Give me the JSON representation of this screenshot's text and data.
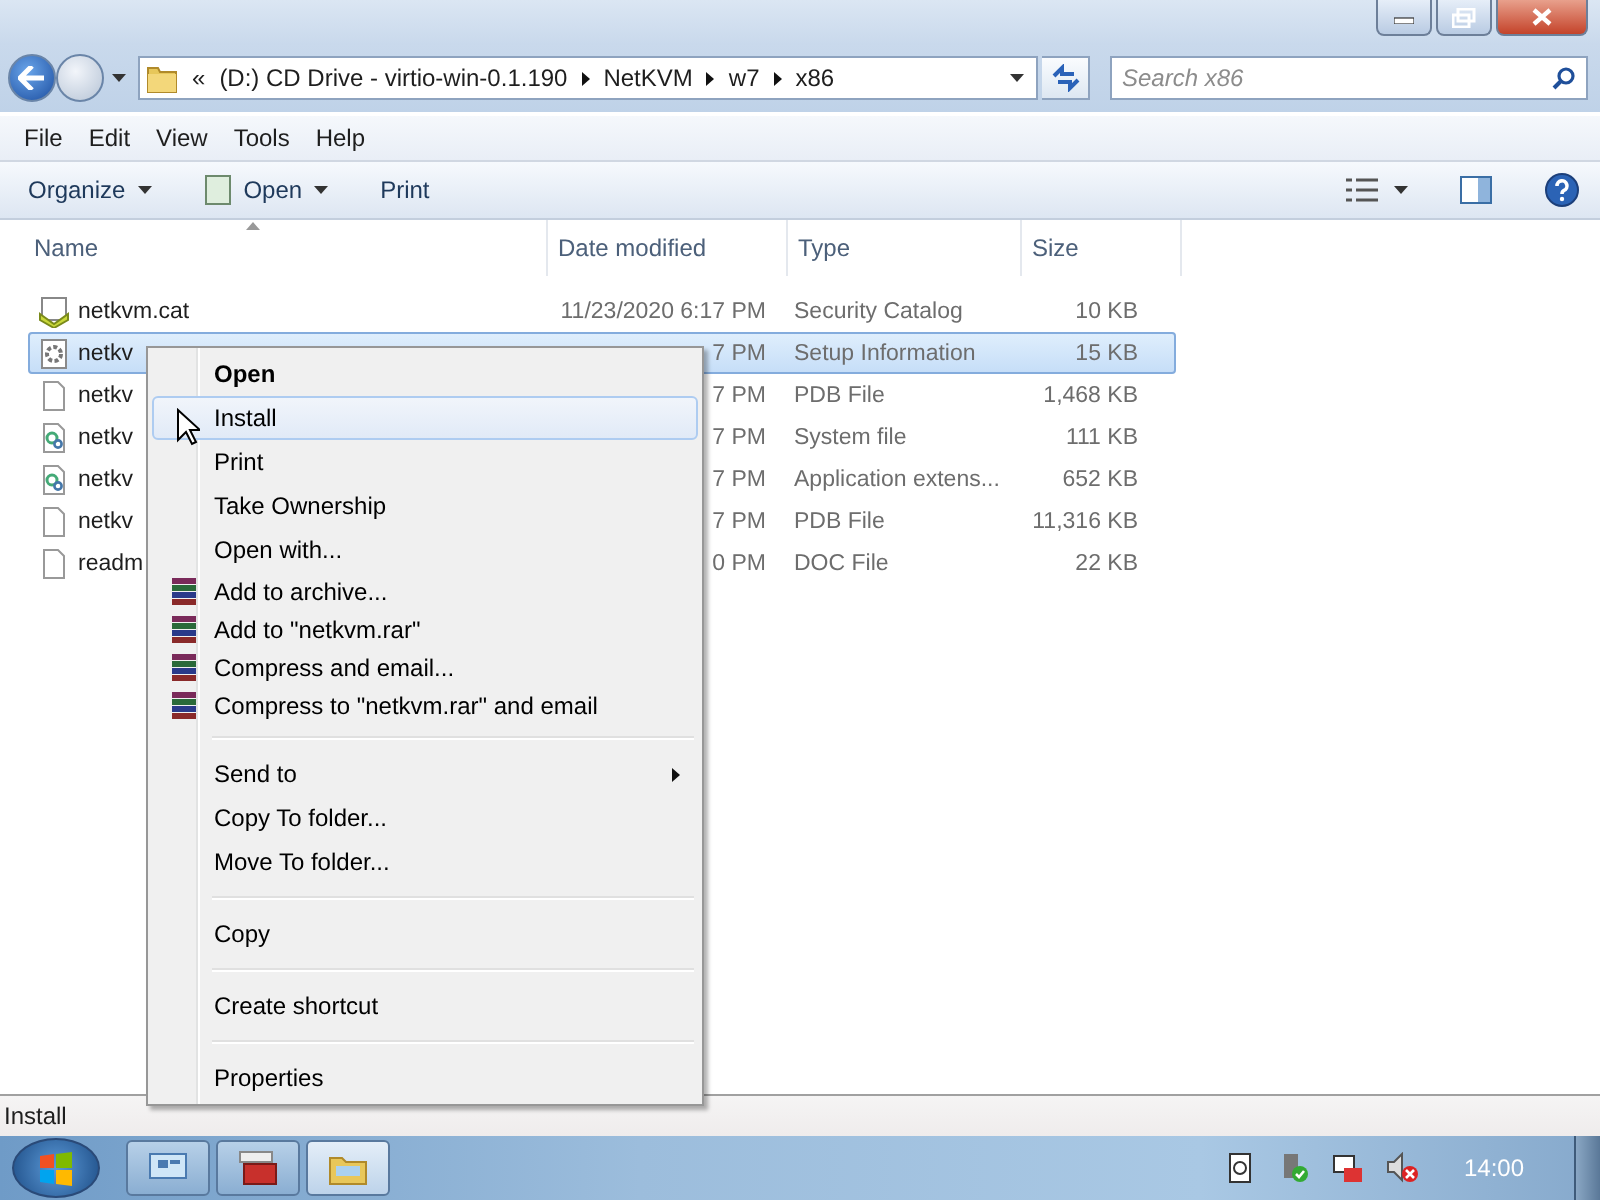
{
  "address": {
    "chevron": "«",
    "crumbs": [
      "(D:) CD Drive - virtio-win-0.1.190",
      "NetKVM",
      "w7",
      "x86"
    ]
  },
  "search": {
    "placeholder": "Search x86"
  },
  "menu_bar": [
    "File",
    "Edit",
    "View",
    "Tools",
    "Help"
  ],
  "commands": [
    {
      "label": "Organize",
      "dropdown": true,
      "icon": false
    },
    {
      "label": "Open",
      "dropdown": true,
      "icon": true
    },
    {
      "label": "Print",
      "dropdown": false,
      "icon": false
    }
  ],
  "columns": [
    "Name",
    "Date modified",
    "Type",
    "Size"
  ],
  "rows": [
    {
      "kind": "catalog",
      "name": "netkvm.cat",
      "date": "11/23/2020 6:17 PM",
      "type": "Security Catalog",
      "size": "10 KB",
      "selected": false
    },
    {
      "kind": "setup",
      "name": "netkv",
      "date": "7 PM",
      "type": "Setup Information",
      "size": "15 KB",
      "selected": true
    },
    {
      "kind": "blank",
      "name": "netkv",
      "date": "7 PM",
      "type": "PDB File",
      "size": "1,468 KB",
      "selected": false
    },
    {
      "kind": "gear",
      "name": "netkv",
      "date": "7 PM",
      "type": "System file",
      "size": "111 KB",
      "selected": false
    },
    {
      "kind": "gear",
      "name": "netkv",
      "date": "7 PM",
      "type": "Application extens...",
      "size": "652 KB",
      "selected": false
    },
    {
      "kind": "blank",
      "name": "netkv",
      "date": "7 PM",
      "type": "PDB File",
      "size": "11,316 KB",
      "selected": false
    },
    {
      "kind": "blank",
      "name": "readm",
      "date": "0 PM",
      "type": "DOC File",
      "size": "22 KB",
      "selected": false
    }
  ],
  "context_menu": [
    {
      "kind": "item",
      "label": "Open",
      "default": true,
      "selected": false
    },
    {
      "kind": "item",
      "label": "Install",
      "default": false,
      "selected": true
    },
    {
      "kind": "item",
      "label": "Print",
      "default": false,
      "selected": false
    },
    {
      "kind": "item",
      "label": "Take Ownership",
      "default": false,
      "selected": false
    },
    {
      "kind": "item",
      "label": "Open with...",
      "default": false,
      "selected": false
    },
    {
      "kind": "archive",
      "label": "Add to archive...",
      "default": false,
      "selected": false
    },
    {
      "kind": "archive",
      "label": "Add to \"netkvm.rar\"",
      "default": false,
      "selected": false
    },
    {
      "kind": "archive",
      "label": "Compress and email...",
      "default": false,
      "selected": false
    },
    {
      "kind": "archive",
      "label": "Compress to \"netkvm.rar\" and email",
      "default": false,
      "selected": false
    },
    {
      "kind": "separator"
    },
    {
      "kind": "submenu",
      "label": "Send to",
      "default": false,
      "selected": false
    },
    {
      "kind": "item",
      "label": "Copy To folder...",
      "default": false,
      "selected": false
    },
    {
      "kind": "item",
      "label": "Move To folder...",
      "default": false,
      "selected": false
    },
    {
      "kind": "separator"
    },
    {
      "kind": "item",
      "label": "Copy",
      "default": false,
      "selected": false
    },
    {
      "kind": "separator"
    },
    {
      "kind": "item",
      "label": "Create shortcut",
      "default": false,
      "selected": false
    },
    {
      "kind": "separator"
    },
    {
      "kind": "item",
      "label": "Properties",
      "default": false,
      "selected": false
    }
  ],
  "status_bar": "Install",
  "taskbar": {
    "clock": "14:00"
  }
}
